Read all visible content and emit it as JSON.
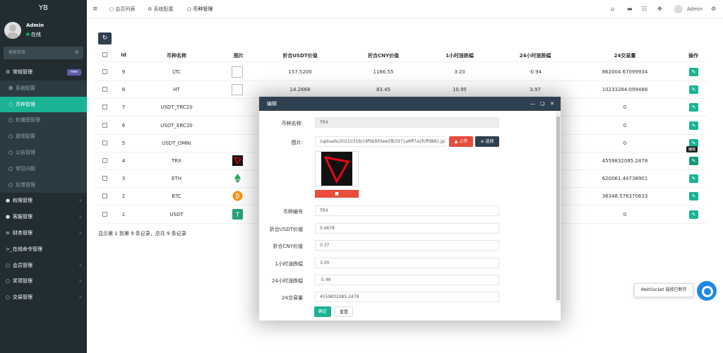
{
  "sidebar": {
    "logo": "YB",
    "user_name": "Admin",
    "user_status": "在线",
    "search_placeholder": "搜索菜单",
    "items": [
      {
        "label": "常规管理",
        "badge": "new",
        "type": "group"
      },
      {
        "label": "系统配置",
        "type": "sub"
      },
      {
        "label": "币种管理",
        "type": "sub-active"
      },
      {
        "label": "轮播图管理",
        "type": "sub"
      },
      {
        "label": "提现配置",
        "type": "sub"
      },
      {
        "label": "公告管理",
        "type": "sub"
      },
      {
        "label": "常见问题",
        "type": "sub"
      },
      {
        "label": "反馈管理",
        "type": "sub"
      },
      {
        "label": "权限管理",
        "type": "group"
      },
      {
        "label": "客服管理",
        "type": "group"
      },
      {
        "label": "财务管理",
        "type": "group"
      },
      {
        "label": "在线命令管理",
        "type": "group"
      },
      {
        "label": "会员管理",
        "type": "group"
      },
      {
        "label": "奖项管理",
        "type": "group"
      },
      {
        "label": "交易管理",
        "type": "group"
      }
    ]
  },
  "topbar": {
    "tabs": [
      "会员列表",
      "系统配置",
      "币种管理"
    ],
    "user": "Admin"
  },
  "table": {
    "headers": [
      "Id",
      "币种名称",
      "图片",
      "折合USDT价值",
      "折合CNY价值",
      "1小时涨跌幅",
      "24小时涨跌幅",
      "24交易量",
      "操作"
    ],
    "rows": [
      {
        "id": "9",
        "name": "LTC",
        "img": "broken",
        "usdt": "157.5200",
        "cny": "1166.55",
        "h1": "3.20",
        "h24": "-0.94",
        "vol": "862004.67099934"
      },
      {
        "id": "8",
        "name": "HT",
        "img": "broken",
        "usdt": "14.2668",
        "cny": "83.45",
        "h1": "10.95",
        "h24": "3.97",
        "vol": "10233284.099488"
      },
      {
        "id": "7",
        "name": "USDT_TRC20",
        "img": "",
        "usdt": "",
        "cny": "",
        "h1": "",
        "h24": "",
        "vol": "0"
      },
      {
        "id": "6",
        "name": "USDT_ERC20",
        "img": "",
        "usdt": "",
        "cny": "",
        "h1": "",
        "h24": "",
        "vol": "0"
      },
      {
        "id": "5",
        "name": "USDT_OMNI",
        "img": "",
        "usdt": "",
        "cny": "",
        "h1": "",
        "h24": "",
        "vol": "0"
      },
      {
        "id": "4",
        "name": "TRX",
        "img": "trx",
        "usdt": "",
        "cny": "",
        "h1": "",
        "h24": "",
        "vol": "4559832085.2478"
      },
      {
        "id": "3",
        "name": "ETH",
        "img": "eth",
        "usdt": "",
        "cny": "",
        "h1": "",
        "h24": "",
        "vol": "620061.44738901"
      },
      {
        "id": "2",
        "name": "BTC",
        "img": "btc",
        "usdt": "",
        "cny": "",
        "h1": "",
        "h24": "",
        "vol": "36348.576370633"
      },
      {
        "id": "1",
        "name": "USDT",
        "img": "usdt",
        "usdt": "",
        "cny": "",
        "h1": "",
        "h24": "",
        "vol": "0"
      }
    ],
    "footer": "显示第 1 到第 9 条记录，总共 9 条记录",
    "tooltip": "编辑"
  },
  "modal": {
    "title": "编辑",
    "fields": {
      "name_label": "币种名称:",
      "name_value": "TRX",
      "image_label": "图片:",
      "image_value": "/uploads/20210316/19f9b955ee5fb3371a6ff7a2fcffd881.jpg",
      "upload_label": "上传",
      "choose_label": "选择",
      "code_label": "币种编号",
      "code_value": "TRX",
      "usdt_label": "折合USDT价值",
      "usdt_value": "0.0678",
      "cny_label": "折合CNY价值",
      "cny_value": "0.37",
      "h1_label": "1小时涨跌幅",
      "h1_value": "3.00",
      "h24_label": "24小时涨跌幅",
      "h24_value": "-5.46",
      "vol_label": "24交易量",
      "vol_value": "4559832085.2478"
    },
    "confirm_label": "确定",
    "reset_label": "重置"
  },
  "websocket": {
    "message": "WebSocket 链接已断开"
  },
  "colors": {
    "accent": "#1ab394",
    "sidebar": "#222d32",
    "header": "#2f4050",
    "danger": "#e74c3c"
  }
}
